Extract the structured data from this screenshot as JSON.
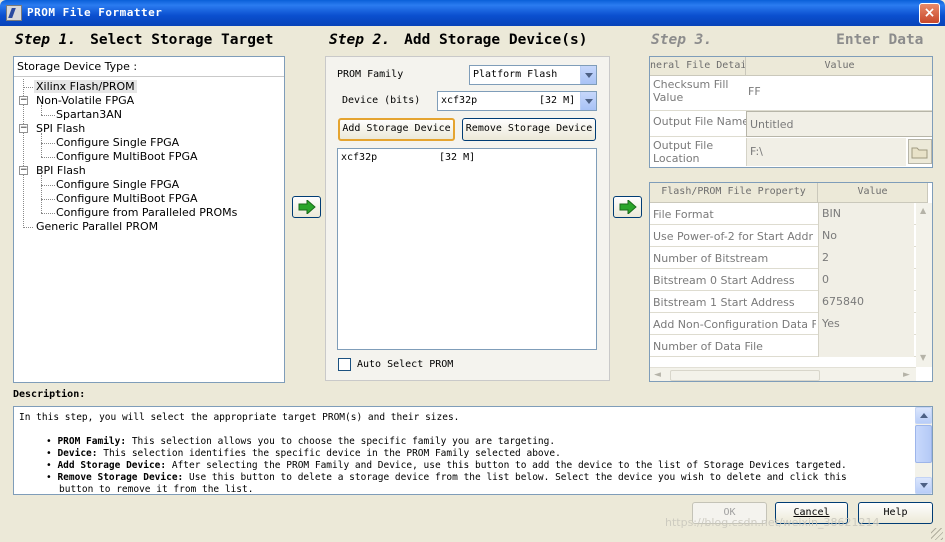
{
  "window": {
    "title": "PROM File Formatter",
    "close_label": "×"
  },
  "steps": {
    "step1": {
      "num": "Step 1.",
      "title": "Select Storage Target"
    },
    "step2": {
      "num": "Step 2.",
      "title": "Add Storage Device(s)"
    },
    "step3": {
      "num": "Step 3.",
      "title": "Enter Data"
    }
  },
  "tree": {
    "header": "Storage Device Type :",
    "items": [
      "Xilinx Flash/PROM",
      "Non-Volatile FPGA",
      "Spartan3AN",
      "SPI Flash",
      "Configure Single FPGA",
      "Configure MultiBoot FPGA",
      "BPI Flash",
      "Configure Single FPGA",
      "Configure MultiBoot FPGA",
      "Configure from Paralleled PROMs",
      "Generic Parallel PROM"
    ]
  },
  "step2": {
    "prom_family_label": "PROM Family",
    "prom_family_value": "Platform Flash",
    "device_label": "Device (bits)",
    "device_value": "xcf32p",
    "device_size": "[32 M]",
    "add_button": "Add Storage Device",
    "remove_button": "Remove Storage Device",
    "devices": [
      {
        "name": "xcf32p",
        "size": "[32 M]"
      }
    ],
    "auto_select_label": "Auto Select PROM"
  },
  "general_grid": {
    "col1": "General File Detail",
    "col2": "Value",
    "rows": [
      {
        "label": "Checksum Fill Value",
        "value": "FF"
      },
      {
        "label": "Output File Name",
        "value": "Untitled"
      },
      {
        "label": "Output File Location",
        "value": "F:\\"
      }
    ]
  },
  "property_grid": {
    "col1": "Flash/PROM File Property",
    "col2": "Value",
    "rows": [
      {
        "label": "File Format",
        "value": "BIN"
      },
      {
        "label": "Use Power-of-2 for Start Addr",
        "value": "No"
      },
      {
        "label": "Number of Bitstream",
        "value": "2"
      },
      {
        "label": "Bitstream 0 Start Address",
        "value": "0"
      },
      {
        "label": "Bitstream 1 Start Address",
        "value": "675840"
      },
      {
        "label": "Add Non-Configuration Data Files",
        "value": "Yes"
      },
      {
        "label": "Number of Data File",
        "value": ""
      }
    ]
  },
  "description": {
    "label": "Description:",
    "intro": "In this step, you will select the appropriate target PROM(s) and their sizes.",
    "bullets": [
      {
        "term": "PROM Family:",
        "text": "This selection allows you to choose the specific family you are targeting."
      },
      {
        "term": "Device:",
        "text": "This selection identifies the specific device in the PROM Family selected above."
      },
      {
        "term": "Add Storage Device:",
        "text": "After selecting the PROM Family and Device, use this button to add the device to the list of Storage Devices targeted."
      },
      {
        "term": "Remove Storage Device:",
        "text": "Use this button to delete a storage device from the list below. Select the device you wish to delete and click this"
      }
    ],
    "continuation": "button to remove it from the list."
  },
  "footer": {
    "ok": "OK",
    "cancel": "Cancel",
    "help": "Help",
    "watermark": "https://blog.csdn.net/weixin_38621214"
  },
  "colors": {
    "titlebar": "#0a4fcf",
    "dialog_bg": "#ece9d8",
    "border": "#7f9db9",
    "arrow_green": "#2aa52a"
  }
}
